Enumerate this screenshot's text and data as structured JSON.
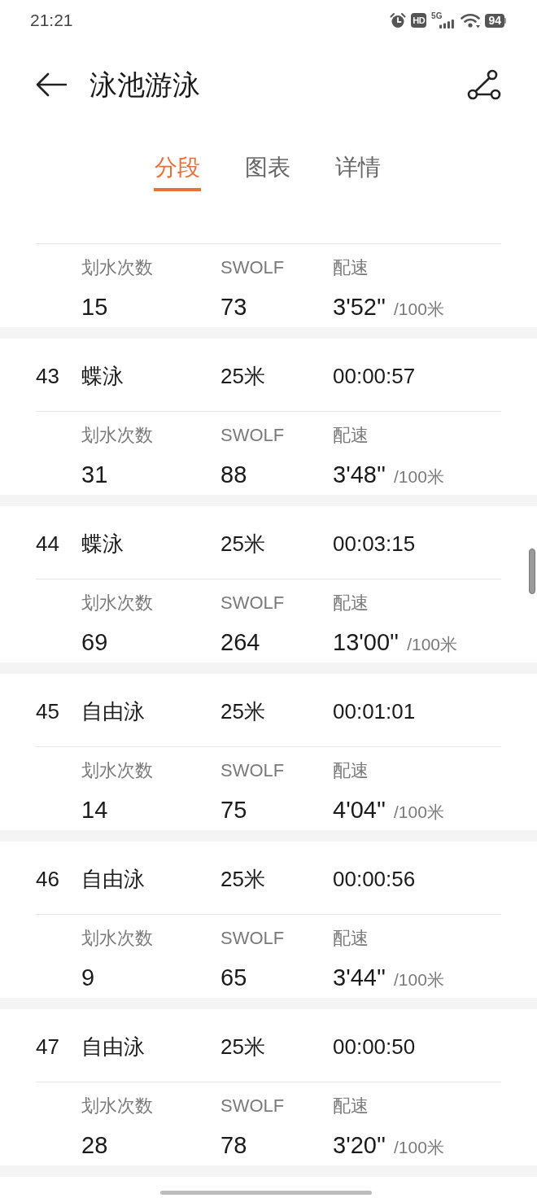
{
  "status_bar": {
    "time": "21:21",
    "hd": "HD",
    "network": "5G",
    "battery": "94"
  },
  "header": {
    "title": "泳池游泳"
  },
  "tabs": [
    {
      "label": "分段",
      "selected": true
    },
    {
      "label": "图表",
      "selected": false
    },
    {
      "label": "详情",
      "selected": false
    }
  ],
  "laps": [
    {
      "stats": [
        {
          "label": "划水次数",
          "value": "15"
        },
        {
          "label": "SWOLF",
          "value": "73"
        },
        {
          "label": "配速",
          "value": "3'52''",
          "unit": "/100米"
        }
      ]
    },
    {
      "lap": "43",
      "stroke": "蝶泳",
      "distance": "25米",
      "time": "00:00:57",
      "stats": [
        {
          "label": "划水次数",
          "value": "31"
        },
        {
          "label": "SWOLF",
          "value": "88"
        },
        {
          "label": "配速",
          "value": "3'48''",
          "unit": "/100米"
        }
      ]
    },
    {
      "lap": "44",
      "stroke": "蝶泳",
      "distance": "25米",
      "time": "00:03:15",
      "stats": [
        {
          "label": "划水次数",
          "value": "69"
        },
        {
          "label": "SWOLF",
          "value": "264"
        },
        {
          "label": "配速",
          "value": "13'00''",
          "unit": "/100米"
        }
      ]
    },
    {
      "lap": "45",
      "stroke": "自由泳",
      "distance": "25米",
      "time": "00:01:01",
      "stats": [
        {
          "label": "划水次数",
          "value": "14"
        },
        {
          "label": "SWOLF",
          "value": "75"
        },
        {
          "label": "配速",
          "value": "4'04''",
          "unit": "/100米"
        }
      ]
    },
    {
      "lap": "46",
      "stroke": "自由泳",
      "distance": "25米",
      "time": "00:00:56",
      "stats": [
        {
          "label": "划水次数",
          "value": "9"
        },
        {
          "label": "SWOLF",
          "value": "65"
        },
        {
          "label": "配速",
          "value": "3'44''",
          "unit": "/100米"
        }
      ]
    },
    {
      "lap": "47",
      "stroke": "自由泳",
      "distance": "25米",
      "time": "00:00:50",
      "stats": [
        {
          "label": "划水次数",
          "value": "28"
        },
        {
          "label": "SWOLF",
          "value": "78"
        },
        {
          "label": "配速",
          "value": "3'20''",
          "unit": "/100米"
        }
      ]
    }
  ]
}
